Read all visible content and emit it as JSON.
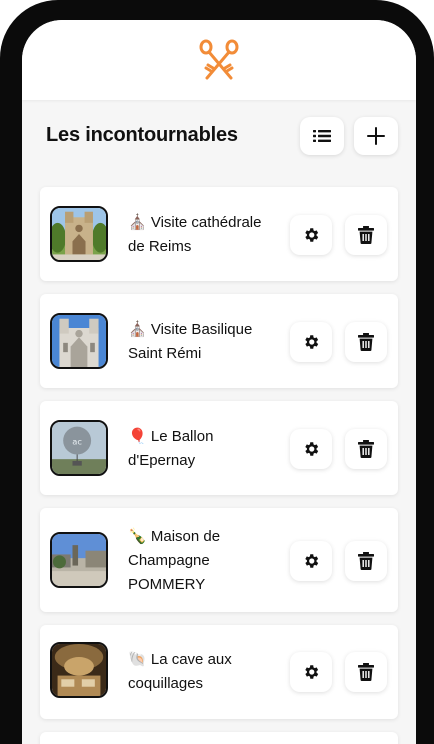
{
  "app": {
    "logo_icon": "crossed-keys-logo-icon",
    "accent_color": "#f28c38"
  },
  "header": {
    "title": "Les incontournables",
    "list_button_icon": "list-icon",
    "add_button_icon": "plus-icon"
  },
  "places": [
    {
      "emoji": "⛪",
      "title": "Visite cathédrale de Reims",
      "image": "cathedral-photo"
    },
    {
      "emoji": "⛪",
      "title": "Visite Basilique Saint Rémi",
      "image": "basilica-photo"
    },
    {
      "emoji": "🎈",
      "title": "Le Ballon d'Epernay",
      "image": "balloon-photo"
    },
    {
      "emoji": "🍾",
      "title": "Maison de Champagne POMMERY",
      "image": "pommery-photo"
    },
    {
      "emoji": "🐚",
      "title": "La cave aux coquillages",
      "image": "cave-photo"
    }
  ],
  "actions": {
    "edit_icon": "gear-icon",
    "delete_icon": "trash-icon"
  }
}
